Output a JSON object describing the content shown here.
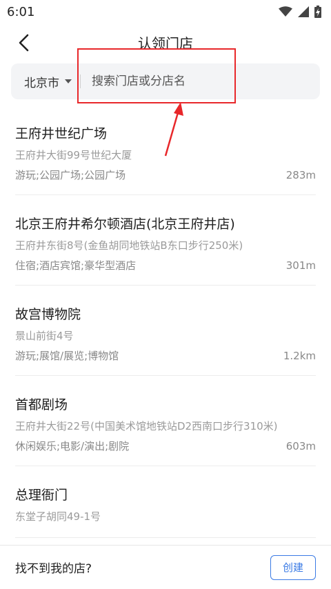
{
  "status_bar": {
    "time": "6:01",
    "icons": [
      "wifi-icon",
      "cellular-signal-icon",
      "battery-charging-icon"
    ]
  },
  "header": {
    "title": "认领门店",
    "back_icon": "chevron-left-icon"
  },
  "search": {
    "city": "北京市",
    "placeholder": "搜索门店或分店名",
    "value": ""
  },
  "stores": [
    {
      "name": "王府井世纪广场",
      "address": "王府井大街99号世纪大厦",
      "category": "游玩;公园广场;公园广场",
      "distance": "283m"
    },
    {
      "name": "北京王府井希尔顿酒店(北京王府井店)",
      "address": "王府井东街8号(金鱼胡同地铁站B东口步行250米)",
      "category": "住宿;酒店宾馆;豪华型酒店",
      "distance": "301m"
    },
    {
      "name": "故宫博物院",
      "address": "景山前街4号",
      "category": "游玩;展馆/展览;博物馆",
      "distance": "1.2km"
    },
    {
      "name": "首都剧场",
      "address": "王府井大街22号(中国美术馆地铁站D2西南口步行310米)",
      "category": "休闲娱乐;电影/演出;剧院",
      "distance": "603m"
    },
    {
      "name": "总理衙门",
      "address": "东堂子胡同49-1号",
      "category": "",
      "distance": ""
    }
  ],
  "bottom_bar": {
    "not_found_label": "找不到我的店?",
    "create_label": "创建"
  },
  "colors": {
    "accent": "#3a7ae4",
    "annotation": "#e8272a",
    "search_bg": "#f3f4f6"
  }
}
